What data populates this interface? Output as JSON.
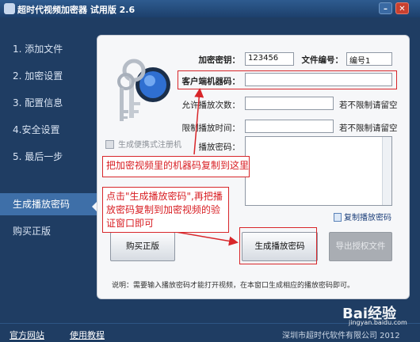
{
  "window": {
    "title": "超时代视频加密器 试用版 2.6"
  },
  "sidebar": {
    "items": [
      {
        "label": "1. 添加文件"
      },
      {
        "label": "2. 加密设置"
      },
      {
        "label": "3. 配置信息"
      },
      {
        "label": "4.安全设置"
      },
      {
        "label": "5. 最后一步"
      },
      {
        "label": "生成播放密码"
      },
      {
        "label": "购买正版"
      }
    ],
    "active_index": 5
  },
  "form": {
    "key_label": "加密密钥：",
    "key_value": "123456",
    "file_no_label": "文件编号：",
    "file_no_value": "编号1",
    "machine_code_label": "客户端机器码：",
    "machine_code_value": "",
    "play_count_label": "允许播放次数：",
    "play_count_value": "",
    "play_count_note": "若不限制请留空",
    "time_limit_label": "限制播放时间：",
    "time_limit_value": "",
    "time_limit_note": "若不限制请留空",
    "password_label": "播放密码：",
    "password_value": ""
  },
  "portable": {
    "label": "生成便携式注册机"
  },
  "copy_password": {
    "label": "复制播放密码"
  },
  "buttons": {
    "buy": "购买正版",
    "generate": "生成播放密码",
    "export": "导出授权文件"
  },
  "tip": "说明：需要输入播放密码才能打开视频，在本窗口生成相应的播放密码即可。",
  "annotations": {
    "note1": "把加密视频里的机器码复制到这里",
    "note2": "点击\"生成播放密码\",再把播放密码复制到加密视频的验证窗口即可"
  },
  "footer": {
    "website": "官方网站",
    "tutorial": "使用教程",
    "copyright": "深圳市超时代软件有限公司 2012"
  },
  "watermark": {
    "brand": "Bai经验",
    "url": "jingyan.baidu.com"
  },
  "colors": {
    "accent": "#1f3d63",
    "annotation": "#d8262a"
  }
}
